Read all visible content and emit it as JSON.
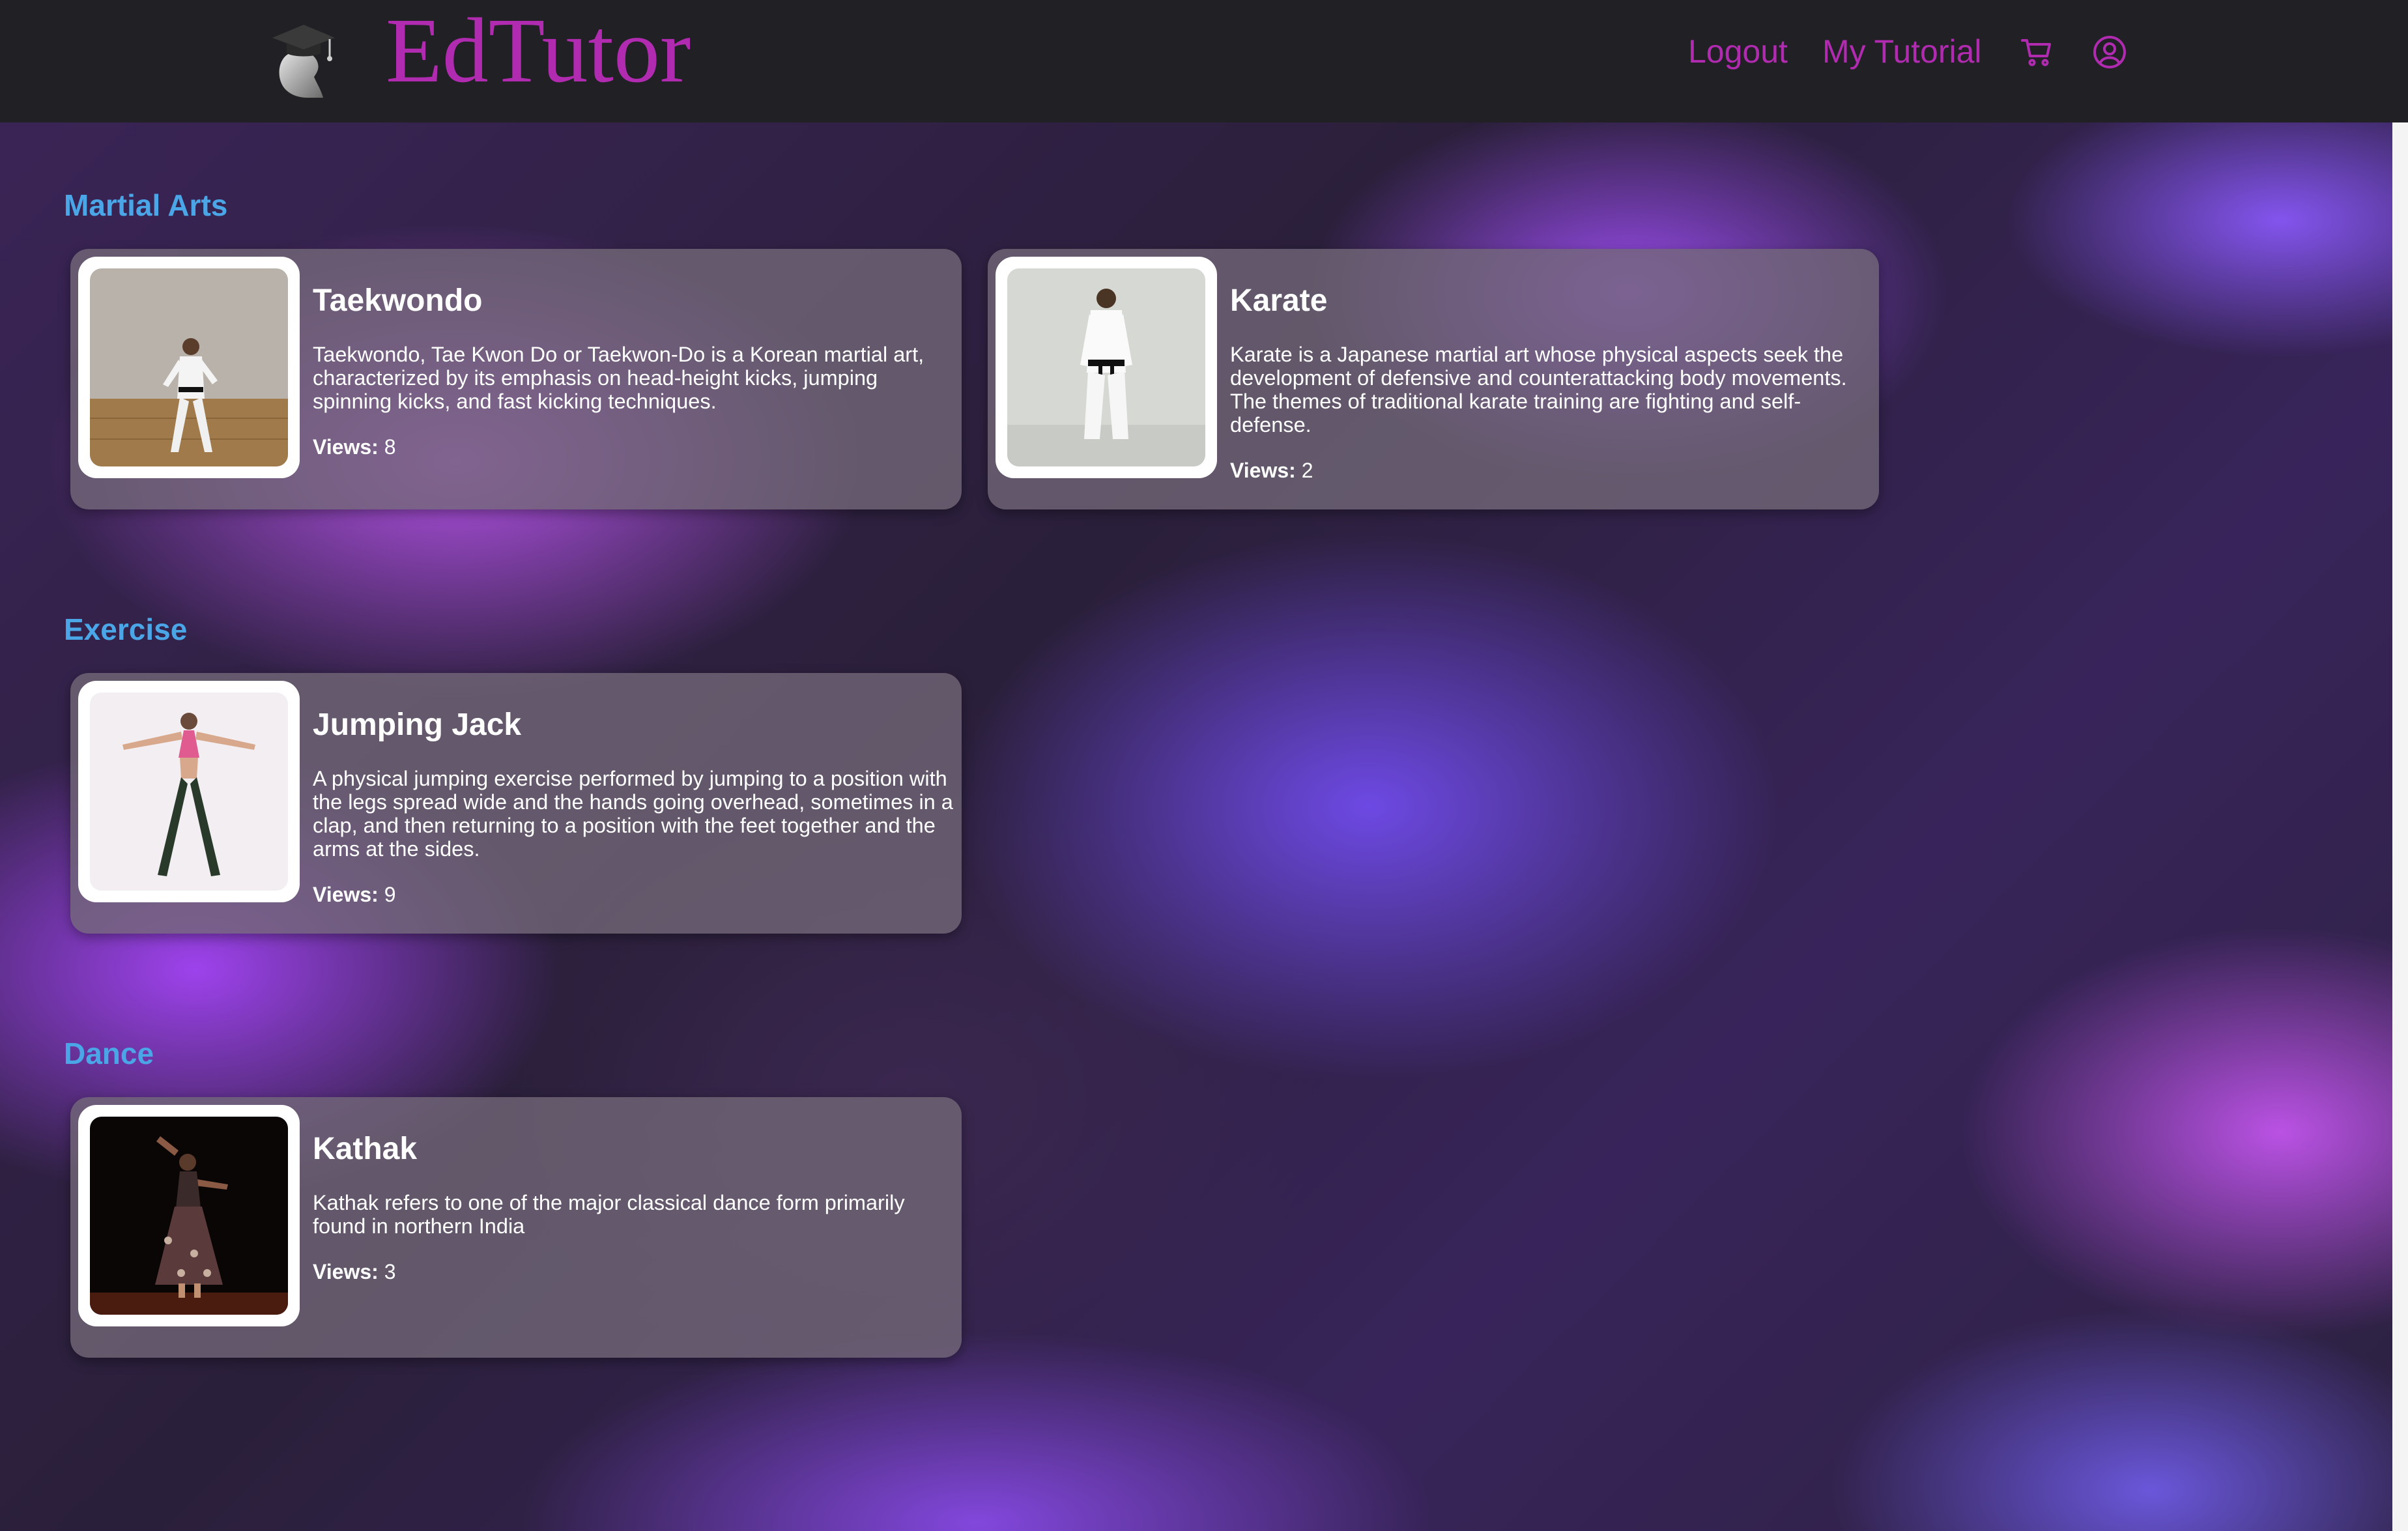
{
  "app": {
    "brand": "EdTutor"
  },
  "nav": {
    "logout": "Logout",
    "my_tutorial": "My Tutorial",
    "cart_icon": "cart-icon",
    "account_icon": "user-circle-icon"
  },
  "colors": {
    "brand": "#b02bb0",
    "section_title": "#4aa6e6",
    "topbar": "#212125"
  },
  "sections": [
    {
      "title": "Martial Arts",
      "cards": [
        {
          "title": "Taekwondo",
          "description": "Taekwondo, Tae Kwon Do or Taekwon-Do is a Korean martial art, characterized by its emphasis on head-height kicks, jumping spinning kicks, and fast kicking techniques.",
          "views_label": "Views:",
          "views": "8"
        },
        {
          "title": "Karate",
          "description": "Karate is a Japanese martial art whose physical aspects seek the development of defensive and counterattacking body movements. The themes of traditional karate training are fighting and self-defense.",
          "views_label": "Views:",
          "views": "2"
        }
      ]
    },
    {
      "title": "Exercise",
      "cards": [
        {
          "title": "Jumping Jack",
          "description": "A physical jumping exercise performed by jumping to a position with the legs spread wide and the hands going overhead, sometimes in a clap, and then returning to a position with the feet together and the arms at the sides.",
          "views_label": "Views:",
          "views": "9"
        }
      ]
    },
    {
      "title": "Dance",
      "cards": [
        {
          "title": "Kathak",
          "description": "Kathak refers to one of the major classical dance form primarily found in northern India",
          "views_label": "Views:",
          "views": "3"
        }
      ]
    }
  ]
}
